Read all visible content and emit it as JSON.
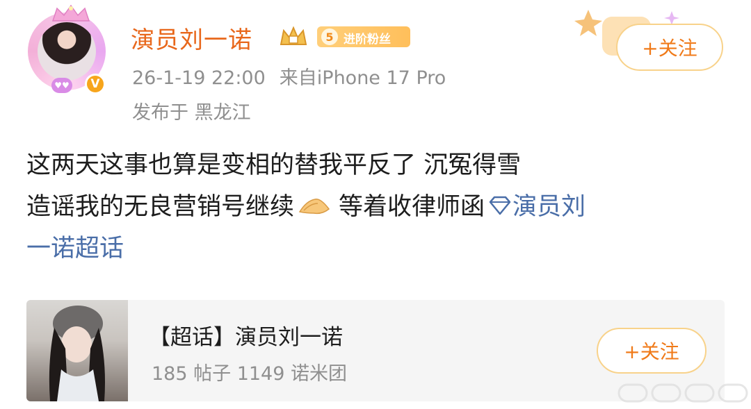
{
  "header": {
    "username": "演员刘一诺",
    "verified_badge": "V",
    "fan_badge_level": "5",
    "fan_badge_text": "进阶粉丝",
    "time": "26-1-19 22:00",
    "source": "来自iPhone 17 Pro",
    "location": "发布于 黑龙江",
    "follow_label": "+关注"
  },
  "post": {
    "line1": "这两天这事也算是变相的替我平反了 沉冤得雪",
    "line2_text": "造谣我的无良营销号继续",
    "line2_after_emoji": "等着收律师函",
    "topic_part1": "演员刘",
    "topic_part2": "一诺超话"
  },
  "card": {
    "title": "【超话】演员刘一诺",
    "stats": "185 帖子 1149 诺米团",
    "follow_label": "+关注"
  },
  "icons": {
    "emoji": "pray-hands-icon",
    "topic": "diamond-icon"
  },
  "colors": {
    "username": "#e8671b",
    "topic_link": "#4a6ea8",
    "follow_text": "#f07a19",
    "meta_text": "#8f8f8f"
  }
}
